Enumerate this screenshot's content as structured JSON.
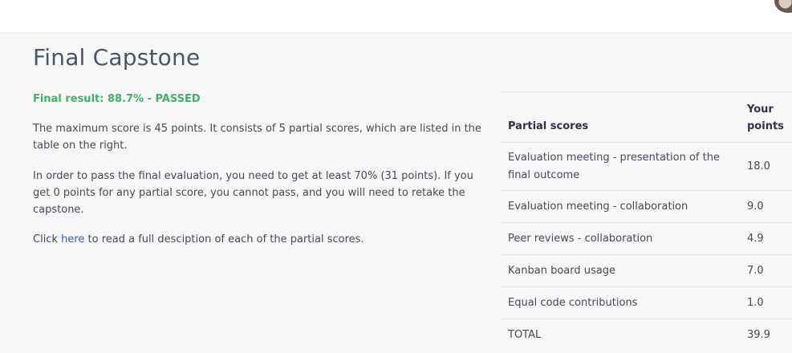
{
  "page_title": "Final Capstone",
  "final_result": "Final result: 88.7% - PASSED",
  "paragraphs": {
    "max_score": "The maximum score is 45 points. It consists of 5 partial scores, which are listed in the table on the right.",
    "pass_requirement": "In order to pass the final evaluation, you need to get at least 70% (31 points). If you get 0 points for any partial score, you cannot pass, and you will need to retake the capstone.",
    "click_prefix": "Click ",
    "click_link": "here",
    "click_suffix": " to read a full desciption of each of the partial scores."
  },
  "table": {
    "headers": [
      "Partial scores",
      "Your points"
    ],
    "rows": [
      {
        "label": "Evaluation meeting - presentation of the final outcome",
        "points": "18.0"
      },
      {
        "label": "Evaluation meeting - collaboration",
        "points": "9.0"
      },
      {
        "label": "Peer reviews - collaboration",
        "points": "4.9"
      },
      {
        "label": "Kanban board usage",
        "points": "7.0"
      },
      {
        "label": "Equal code contributions",
        "points": "1.0"
      }
    ],
    "total": {
      "label": "TOTAL",
      "points": "39.9"
    }
  },
  "colors": {
    "pass_green": "#3db46d",
    "link_blue": "#3f5ab5"
  }
}
